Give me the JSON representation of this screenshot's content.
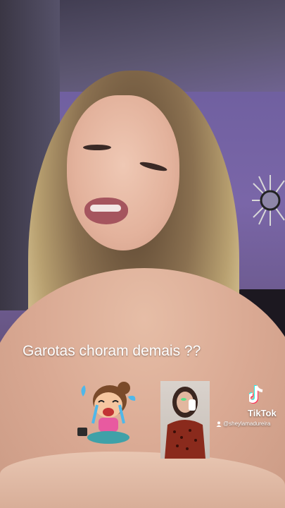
{
  "caption": {
    "text": "Garotas choram demais ??"
  },
  "watermark": {
    "brand": "TikTok",
    "username": "@sheylamadureira",
    "logo_icon": "tiktok-note-icon",
    "user_icon": "person-icon"
  },
  "stickers": {
    "crying_girl": "crying-girl-sticker",
    "crying_woman": "crying-woman-sticker"
  },
  "colors": {
    "wall": "#7a66a8",
    "caption_text": "#ffffff",
    "logo_cyan": "#25f4ee",
    "logo_red": "#fe2c55"
  }
}
